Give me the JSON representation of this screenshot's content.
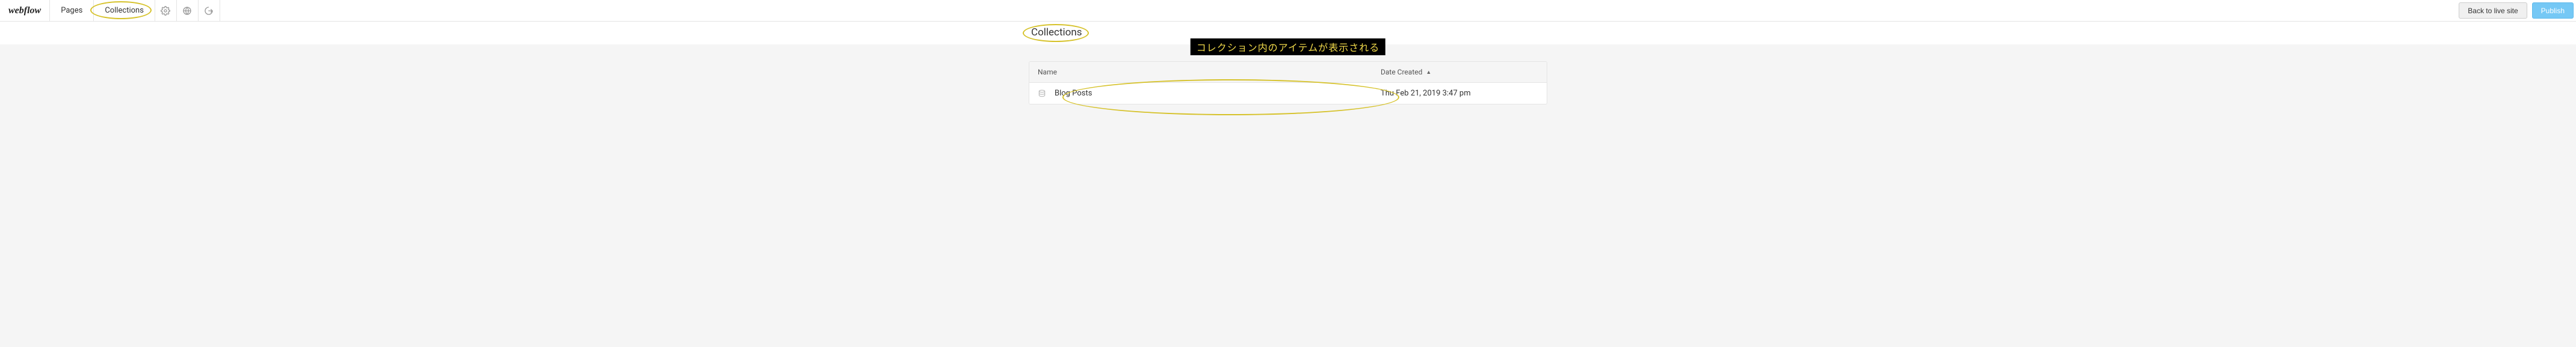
{
  "topbar": {
    "logo": "webflow",
    "nav": {
      "pages": "Pages",
      "collections": "Collections"
    },
    "buttons": {
      "back": "Back to live site",
      "publish": "Publish"
    }
  },
  "page": {
    "title": "Collections"
  },
  "annotation": {
    "text": "コレクション内のアイテムが表示される"
  },
  "table": {
    "headers": {
      "name": "Name",
      "date": "Date Created"
    },
    "rows": [
      {
        "name": "Blog Posts",
        "date": "Thu Feb 21, 2019 3:47 pm"
      }
    ]
  }
}
